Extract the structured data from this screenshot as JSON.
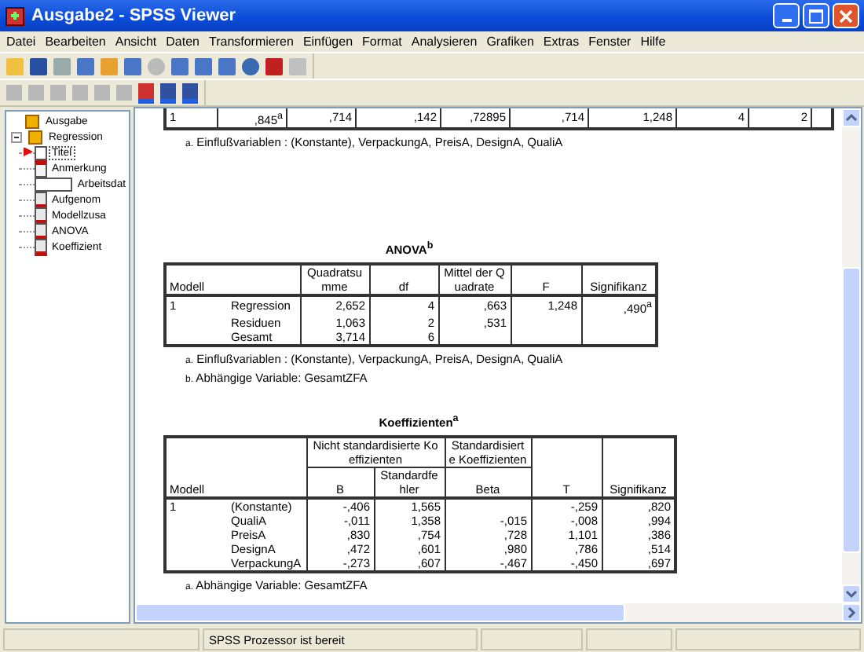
{
  "window": {
    "title": "Ausgabe2 - SPSS Viewer"
  },
  "menu": [
    "Datei",
    "Bearbeiten",
    "Ansicht",
    "Daten",
    "Transformieren",
    "Einfügen",
    "Format",
    "Analysieren",
    "Grafiken",
    "Extras",
    "Fenster",
    "Hilfe"
  ],
  "tree": [
    {
      "label": "Ausgabe",
      "selected": false,
      "children": [
        {
          "label": "Regression",
          "selected": false,
          "expanded": true,
          "children": [
            {
              "label": "Titel",
              "kind": "title",
              "selected": true
            },
            {
              "label": "Anmerkung",
              "kind": "notes",
              "selected": false
            },
            {
              "label": "Arbeitsdat",
              "kind": "doc",
              "selected": false
            },
            {
              "label": "Aufgenom",
              "kind": "table",
              "selected": false
            },
            {
              "label": "Modellzusa",
              "kind": "table",
              "selected": false
            },
            {
              "label": "ANOVA",
              "kind": "table",
              "selected": false
            },
            {
              "label": "Koeffizient",
              "kind": "table",
              "selected": false
            }
          ]
        }
      ]
    }
  ],
  "model_summary": {
    "row": [
      "1",
      ",845$^{a}$",
      ",714",
      ",142",
      ",72895",
      ",714",
      "1,248",
      "4",
      "2"
    ],
    "footnotes": [
      {
        "marker": "a.",
        "text": "Einflußvariablen : (Konstante), VerpackungA, PreisA, DesignA, QualiA"
      }
    ]
  },
  "anova": {
    "title": "ANOVA$^{b}$",
    "header_rows": [
      [
        {
          "label": "Modell",
          "colspan": 2
        },
        {
          "label": "Quadratsumme"
        },
        {
          "label": "df"
        },
        {
          "label": "Mittel der Quadrate"
        },
        {
          "label": "F"
        },
        {
          "label": "Signifikanz"
        }
      ]
    ],
    "rows": [
      [
        "1",
        "Regression",
        "2,652",
        "4",
        ",663",
        "1,248",
        ",490$^{a}$"
      ],
      [
        "",
        "Residuen",
        "1,063",
        "2",
        ",531",
        "",
        ""
      ],
      [
        "",
        "Gesamt",
        "3,714",
        "6",
        "",
        "",
        ""
      ]
    ],
    "footnotes": [
      {
        "marker": "a.",
        "text": "Einflußvariablen : (Konstante), VerpackungA, PreisA, DesignA, QualiA"
      },
      {
        "marker": "b.",
        "text": "Abhängige Variable: GesamtZFA"
      }
    ]
  },
  "coefficients": {
    "title": "Koeffizienten$^{a}$",
    "header_rows": [
      [
        {
          "label": "Modell",
          "colspan": 2,
          "rowspan": 2
        },
        {
          "label": "Nicht standardisierte Koeffizienten",
          "colspan": 2
        },
        {
          "label": "Standardisierte Koeffizienten"
        },
        {
          "label": "T",
          "rowspan": 2
        },
        {
          "label": "Signifikanz",
          "rowspan": 2
        }
      ],
      [
        {
          "label": "B"
        },
        {
          "label": "Standardfehler"
        },
        {
          "label": "Beta"
        }
      ]
    ],
    "rows": [
      [
        "1",
        "(Konstante)",
        "-,406",
        "1,565",
        "",
        "-,259",
        ",820"
      ],
      [
        "",
        "QualiA",
        "-,011",
        "1,358",
        "-,015",
        "-,008",
        ",994"
      ],
      [
        "",
        "PreisA",
        ",830",
        ",754",
        ",728",
        "1,101",
        ",386"
      ],
      [
        "",
        "DesignA",
        ",472",
        ",601",
        ",980",
        ",786",
        ",514"
      ],
      [
        "",
        "VerpackungA",
        "-,273",
        ",607",
        "-,467",
        "-,450",
        ",697"
      ]
    ],
    "footnotes": [
      {
        "marker": "a.",
        "text": "Abhängige Variable: GesamtZFA"
      }
    ]
  },
  "status_bar": {
    "text": "SPSS Prozessor ist bereit"
  }
}
